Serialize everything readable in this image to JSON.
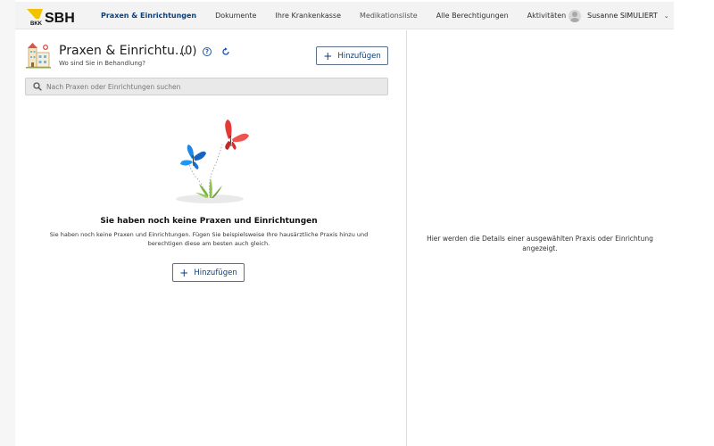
{
  "brand": {
    "logo_text": "SBH",
    "logo_small": "BKK"
  },
  "nav": {
    "items": [
      {
        "label": "Praxen & Einrichtungen",
        "active": true
      },
      {
        "label": "Dokumente"
      },
      {
        "label": "Ihre Krankenkasse"
      },
      {
        "label": "Medikationsliste"
      },
      {
        "label": "Alle Berechtigungen"
      },
      {
        "label": "Aktivitäten"
      }
    ]
  },
  "user": {
    "name": "Susanne SIMULIERT"
  },
  "page": {
    "title": "Praxen & Einrichtu...",
    "count": "(0)",
    "subtitle": "Wo sind Sie in Behandlung?",
    "add_label": "Hinzufügen",
    "search_placeholder": "Nach Praxen oder Einrichtungen suchen"
  },
  "empty": {
    "title": "Sie haben noch keine Praxen und Einrichtungen",
    "text": "Sie haben noch keine Praxen und Einrichtungen. Fügen Sie beispielsweise Ihre hausärztliche Praxis hinzu und berechtigen diese am besten auch gleich.",
    "add_label": "Hinzufügen"
  },
  "detail": {
    "message": "Hier werden die Details einer ausgewählten Praxis oder Einrichtung angezeigt."
  },
  "colors": {
    "accent": "#0d3f7a",
    "logo_yellow": "#f2c200"
  }
}
